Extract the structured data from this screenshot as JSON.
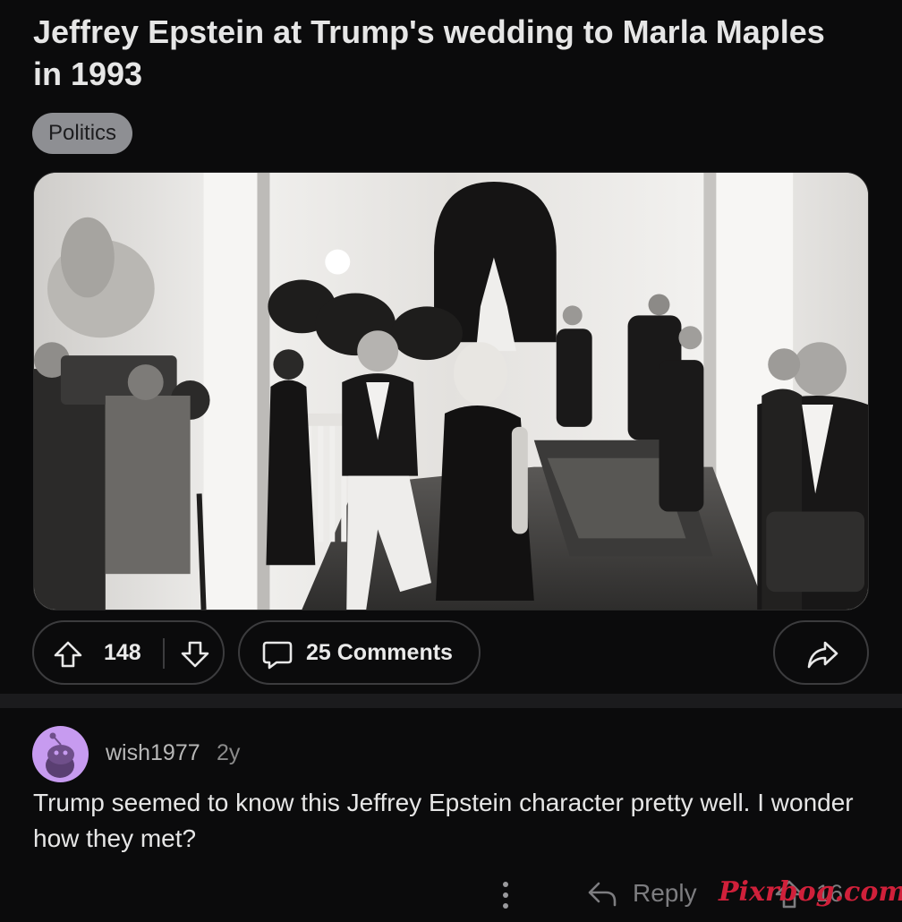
{
  "post": {
    "title": "Jeffrey Epstein at Trump's wedding to Marla Maples in 1993",
    "flair": "Politics",
    "image_icon": "photo",
    "votes": "148",
    "comments_label": "25 Comments",
    "icons": {
      "upvote": "arrow-up-icon",
      "downvote": "arrow-down-icon",
      "comments": "speech-bubble-icon",
      "share": "share-arrow-icon"
    }
  },
  "comment": {
    "author": "wish1977",
    "age": "2y",
    "text": "Trump seemed to know this Jeffrey Epstein character pretty well. I wonder how they met?",
    "reply_label": "Reply",
    "score": "16",
    "icons": {
      "avatar": "snoo-avatar-icon",
      "more": "more-vertical-icon",
      "reply": "reply-arrow-icon",
      "upvote": "arrow-up-icon"
    }
  },
  "watermark": "Pixrbog.com",
  "colors": {
    "background": "#0b0b0c",
    "pill_border": "#3c3c3e",
    "flair_bg": "#8e8f93",
    "avatar_bg": "#c79bf0",
    "watermark": "#d0203a"
  }
}
